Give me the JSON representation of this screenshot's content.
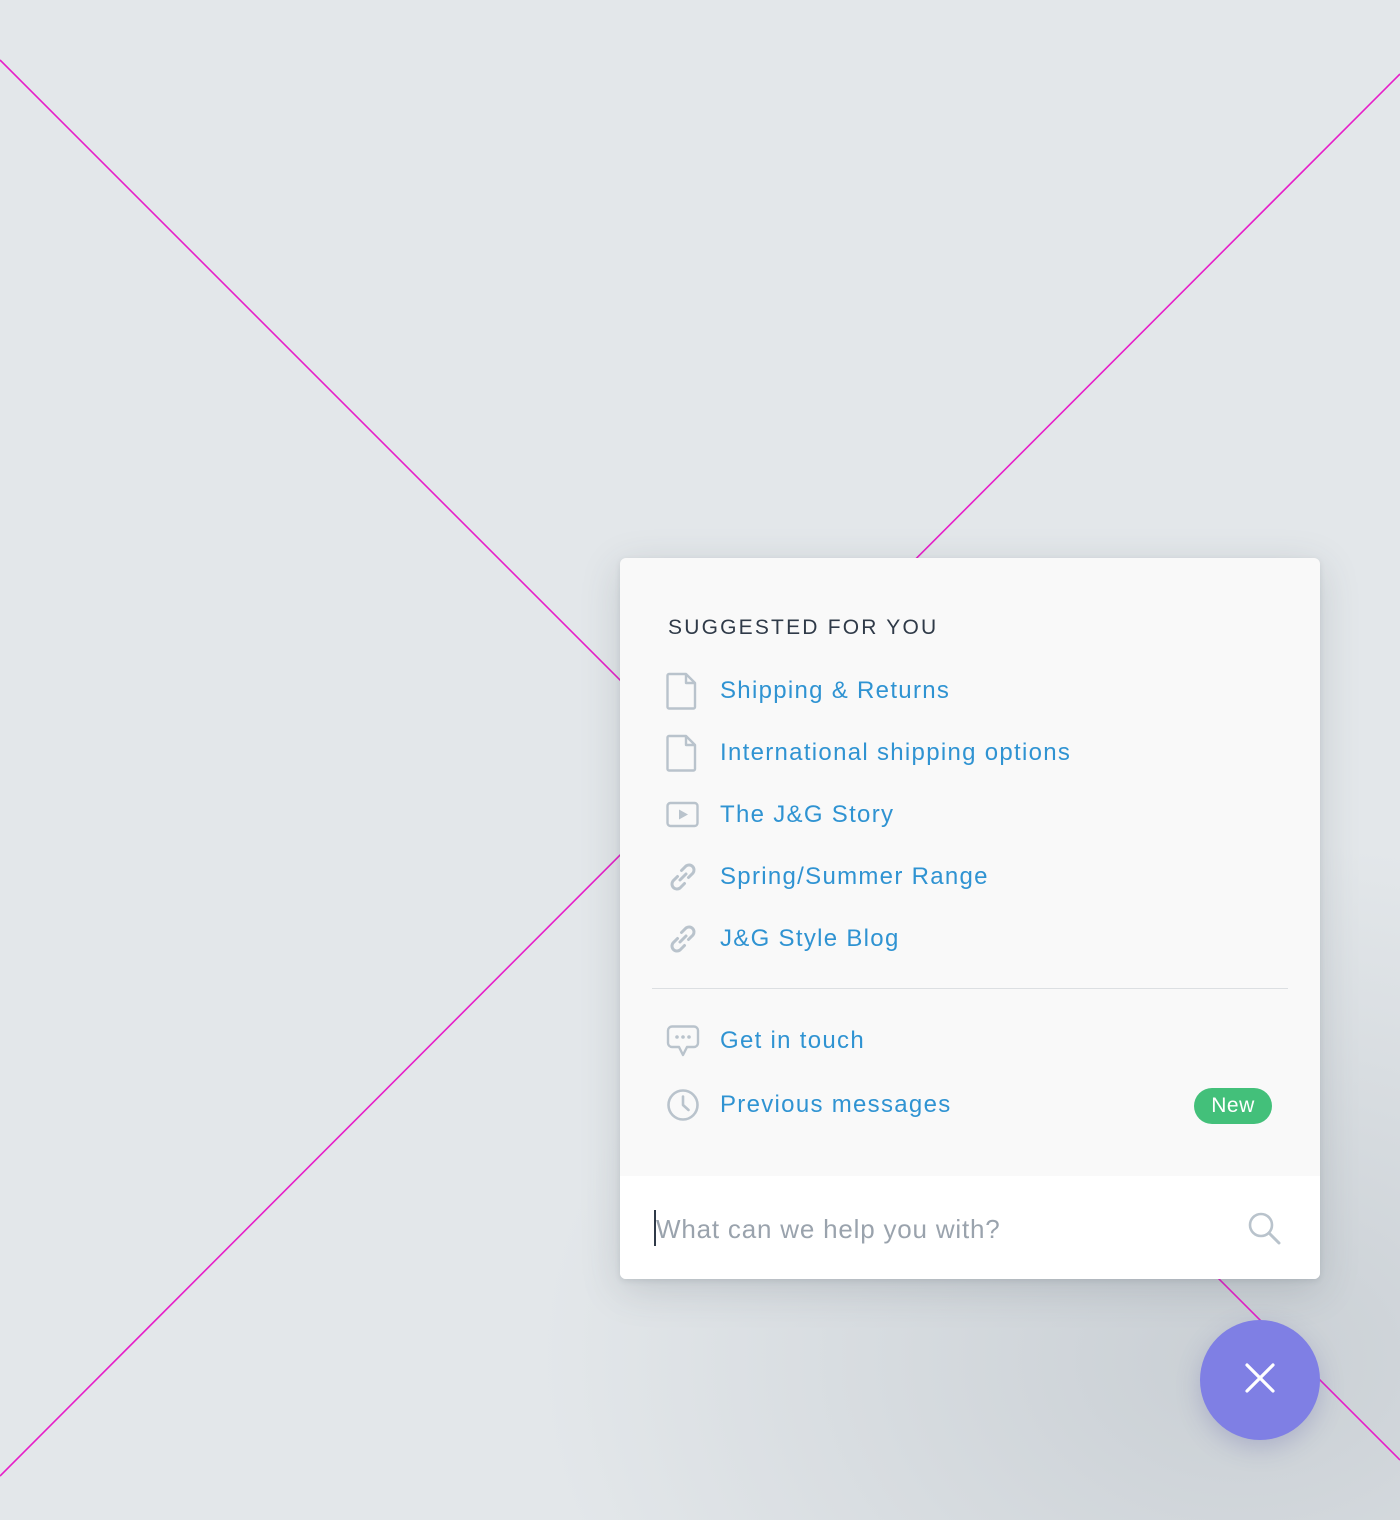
{
  "panel": {
    "section_title": "SUGGESTED FOR YOU",
    "items": [
      {
        "label": "Shipping & Returns",
        "icon": "document-icon"
      },
      {
        "label": "International shipping options",
        "icon": "document-icon"
      },
      {
        "label": "The J&G Story",
        "icon": "video-icon"
      },
      {
        "label": "Spring/Summer Range",
        "icon": "link-icon"
      },
      {
        "label": "J&G Style Blog",
        "icon": "link-icon"
      }
    ],
    "actions": [
      {
        "label": "Get in touch",
        "icon": "chat-icon"
      },
      {
        "label": "Previous messages",
        "icon": "clock-icon",
        "badge": "New"
      }
    ]
  },
  "search": {
    "placeholder": "What can we help you with?",
    "icon": "search-icon"
  },
  "fab": {
    "icon": "close-icon"
  },
  "colors": {
    "background": "#e3e7ea",
    "link": "#2f93d2",
    "badge": "#43c07a",
    "fab": "#7f7fe4",
    "placeholder_lines": "#e61ec8",
    "icon": "#b9c3cc"
  }
}
